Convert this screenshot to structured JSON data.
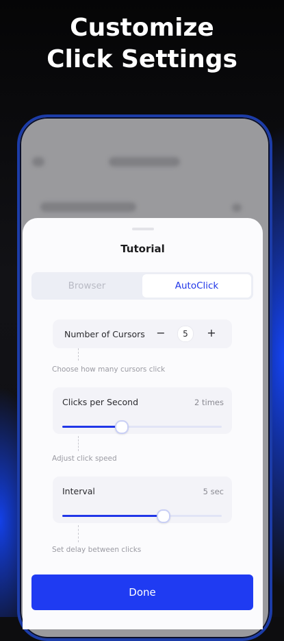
{
  "headline": {
    "line1": "Customize",
    "line2": "Click Settings"
  },
  "sheet": {
    "title": "Tutorial",
    "segments": {
      "left": "Browser",
      "right": "AutoClick",
      "selected": "AutoClick"
    },
    "cursors": {
      "label": "Number of Cursors",
      "minus": "−",
      "plus": "+",
      "value": "5",
      "hint": "Choose how many cursors click"
    },
    "clicks_per_second": {
      "label": "Clicks per Second",
      "value": "2 times",
      "hint": "Adjust click speed",
      "slider_percent": 37
    },
    "interval": {
      "label": "Interval",
      "value": "5 sec",
      "hint": "Set delay between clicks",
      "slider_percent": 63
    },
    "done_label": "Done"
  },
  "colors": {
    "accent": "#1f3bf2",
    "glow": "#1446ff"
  }
}
